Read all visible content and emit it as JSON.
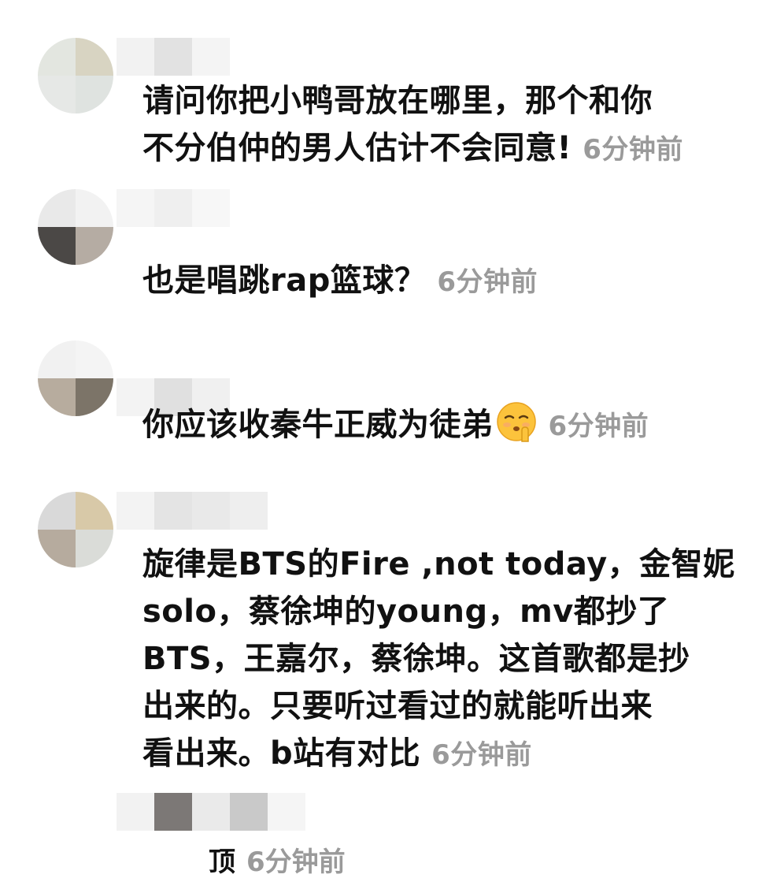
{
  "comments": [
    {
      "lines": [
        "请问你把小鸭哥放在哪里，那个和你",
        "不分伯仲的男人估计不会同意!"
      ],
      "time": "6分钟前"
    },
    {
      "lines": [
        "也是唱跳rap篮球？"
      ],
      "time": "6分钟前"
    },
    {
      "lines": [
        "你应该收秦牛正威为徒弟"
      ],
      "emoji": "shushing-face-emoji",
      "time": "6分钟前"
    },
    {
      "lines": [
        "旋律是BTS的Fire ,not today，金智妮",
        "solo，蔡徐坤的young，mv都抄了",
        "BTS，王嘉尔，蔡徐坤。这首歌都是抄",
        "出来的。只要听过看过的就能听出来",
        "看出来。b站有对比"
      ],
      "time": "6分钟前"
    }
  ],
  "partial_comment": {
    "text": "顶",
    "time": "6分钟前"
  },
  "colors": {
    "text": "#111111",
    "timestamp": "#9a9a9a",
    "background": "#ffffff"
  }
}
